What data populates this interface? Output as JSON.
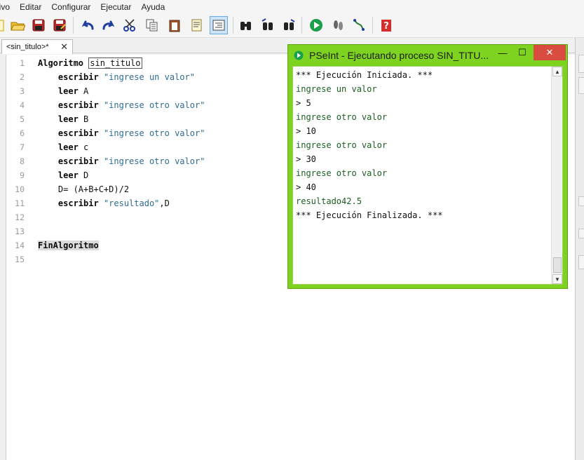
{
  "menu": [
    "chivo",
    "Editar",
    "Configurar",
    "Ejecutar",
    "Ayuda"
  ],
  "editor_tab": {
    "label": "<sin_titulo>*",
    "close": "✕"
  },
  "code_lines": [
    {
      "n": "1",
      "parts": [
        {
          "t": "Algoritmo ",
          "c": "kw"
        },
        {
          "t": "sin_titulo",
          "c": "boxed"
        }
      ]
    },
    {
      "n": "2",
      "parts": [
        {
          "t": "    escribir ",
          "c": "kw"
        },
        {
          "t": "\"ingrese un valor\"",
          "c": "str"
        }
      ]
    },
    {
      "n": "3",
      "parts": [
        {
          "t": "    leer ",
          "c": "kw"
        },
        {
          "t": "A",
          "c": ""
        }
      ]
    },
    {
      "n": "4",
      "parts": [
        {
          "t": "    escribir ",
          "c": "kw"
        },
        {
          "t": "\"ingrese otro valor\"",
          "c": "str"
        }
      ]
    },
    {
      "n": "5",
      "parts": [
        {
          "t": "    leer ",
          "c": "kw"
        },
        {
          "t": "B",
          "c": ""
        }
      ]
    },
    {
      "n": "6",
      "parts": [
        {
          "t": "    escribir ",
          "c": "kw"
        },
        {
          "t": "\"ingrese otro valor\"",
          "c": "str"
        }
      ]
    },
    {
      "n": "7",
      "parts": [
        {
          "t": "    leer ",
          "c": "kw"
        },
        {
          "t": "c",
          "c": ""
        }
      ]
    },
    {
      "n": "8",
      "parts": [
        {
          "t": "    escribir ",
          "c": "kw"
        },
        {
          "t": "\"ingrese otro valor\"",
          "c": "str"
        }
      ]
    },
    {
      "n": "9",
      "parts": [
        {
          "t": "    leer ",
          "c": "kw"
        },
        {
          "t": "D",
          "c": ""
        }
      ]
    },
    {
      "n": "10",
      "parts": [
        {
          "t": "    D= (A+B+C+D)/2",
          "c": ""
        }
      ]
    },
    {
      "n": "11",
      "parts": [
        {
          "t": "    escribir ",
          "c": "kw"
        },
        {
          "t": "\"resultado\"",
          "c": "str"
        },
        {
          "t": ",D",
          "c": ""
        }
      ]
    },
    {
      "n": "12",
      "parts": []
    },
    {
      "n": "13",
      "parts": []
    },
    {
      "n": "14",
      "parts": [
        {
          "t": "FinAlgoritmo",
          "c": "kw hl"
        }
      ]
    },
    {
      "n": "15",
      "parts": []
    }
  ],
  "console": {
    "title": "PSeInt - Ejecutando proceso SIN_TITU...",
    "minimize": "—",
    "maximize": "☐",
    "close": "✕",
    "lines": [
      {
        "t": "*** Ejecución Iniciada. ***",
        "k": "in"
      },
      {
        "t": "ingrese un valor",
        "k": "out"
      },
      {
        "t": "> 5",
        "k": "in"
      },
      {
        "t": "ingrese otro valor",
        "k": "out"
      },
      {
        "t": "> 10",
        "k": "in"
      },
      {
        "t": "ingrese otro valor",
        "k": "out"
      },
      {
        "t": "> 30",
        "k": "in"
      },
      {
        "t": "ingrese otro valor",
        "k": "out"
      },
      {
        "t": "> 40",
        "k": "in"
      },
      {
        "t": "resultado42.5",
        "k": "out"
      },
      {
        "t": "*** Ejecución Finalizada. ***",
        "k": "in"
      }
    ]
  },
  "toolbar": [
    {
      "name": "new-file-icon"
    },
    {
      "name": "open-folder-icon"
    },
    {
      "name": "save-icon"
    },
    {
      "name": "save-as-icon"
    },
    {
      "name": "undo-icon"
    },
    {
      "name": "redo-icon"
    },
    {
      "name": "cut-icon"
    },
    {
      "name": "copy-icon"
    },
    {
      "name": "paste-icon"
    },
    {
      "name": "edit-note-icon"
    },
    {
      "name": "indent-icon"
    },
    {
      "name": "find-icon"
    },
    {
      "name": "find-previous-icon"
    },
    {
      "name": "find-next-icon"
    },
    {
      "name": "run-icon"
    },
    {
      "name": "step-icon"
    },
    {
      "name": "flowchart-icon"
    },
    {
      "name": "help-icon"
    }
  ],
  "colors": {
    "console_frame": "#7ed321",
    "close_red": "#d94c3f",
    "run_green": "#1aa04a"
  }
}
